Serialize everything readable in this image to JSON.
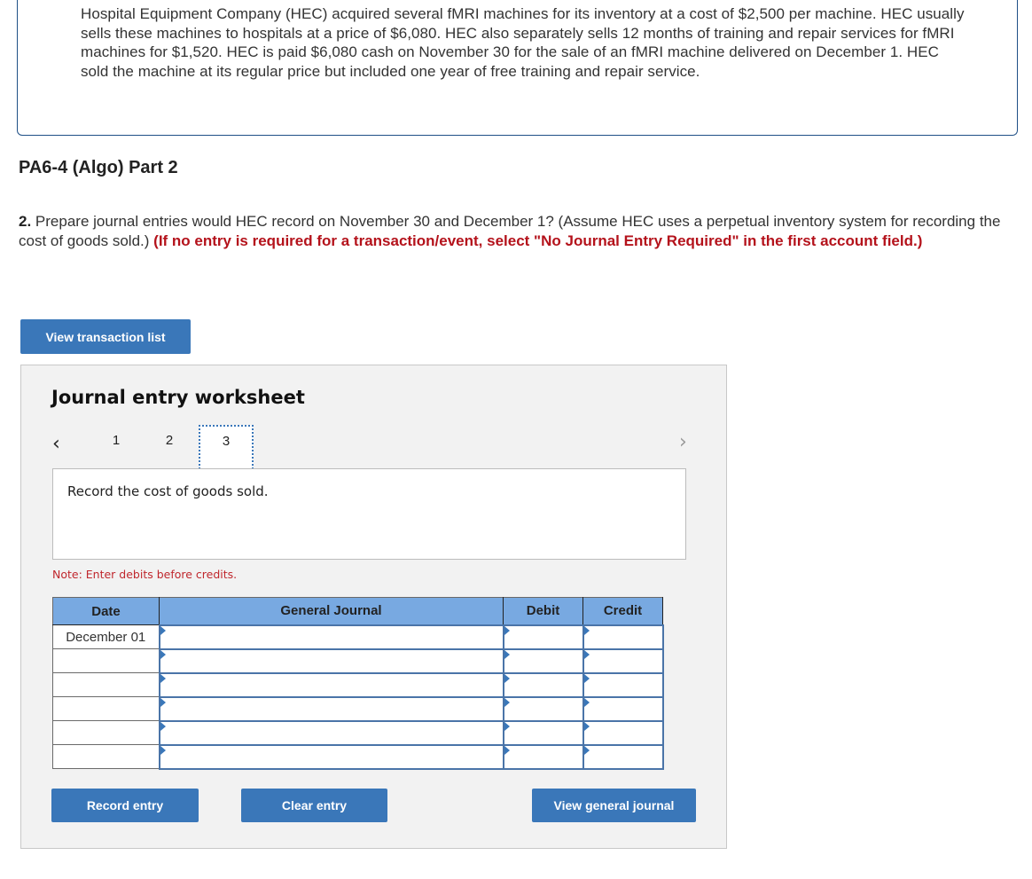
{
  "problem": {
    "text": "Hospital Equipment Company (HEC) acquired several fMRI machines for its inventory at a cost of $2,500 per machine. HEC usually sells these machines to hospitals at a price of $6,080. HEC also separately sells 12 months of training and repair services for fMRI machines for $1,520. HEC is paid $6,080 cash on November 30 for the sale of an fMRI machine delivered on December 1. HEC sold the machine at its regular price but included one year of free training and repair service."
  },
  "part_title": "PA6-4 (Algo) Part 2",
  "question": {
    "number": "2.",
    "text": "Prepare journal entries would HEC record on November 30 and December 1? (Assume HEC uses a perpetual inventory system for recording the cost of goods sold.)",
    "instruction": "(If no entry is required for a transaction/event, select \"No Journal Entry Required\" in the first account field.)"
  },
  "buttons": {
    "view_transaction_list": "View transaction list",
    "record_entry": "Record entry",
    "clear_entry": "Clear entry",
    "view_general_journal": "View general journal"
  },
  "worksheet": {
    "title": "Journal entry worksheet",
    "pages": [
      "1",
      "2",
      "3"
    ],
    "active_page": "3",
    "prompt": "Record the cost of goods sold.",
    "note": "Note: Enter debits before credits.",
    "columns": [
      "Date",
      "General Journal",
      "Debit",
      "Credit"
    ],
    "rows": [
      {
        "date": "December 01",
        "account": "",
        "debit": "",
        "credit": ""
      },
      {
        "date": "",
        "account": "",
        "debit": "",
        "credit": ""
      },
      {
        "date": "",
        "account": "",
        "debit": "",
        "credit": ""
      },
      {
        "date": "",
        "account": "",
        "debit": "",
        "credit": ""
      },
      {
        "date": "",
        "account": "",
        "debit": "",
        "credit": ""
      },
      {
        "date": "",
        "account": "",
        "debit": "",
        "credit": ""
      }
    ]
  },
  "icons": {
    "prev": "‹",
    "next": "›"
  },
  "colors": {
    "accent": "#3a77b9",
    "header_blue": "#78a9e1",
    "instruction_red": "#b4121b",
    "note_red": "#c0272d"
  }
}
